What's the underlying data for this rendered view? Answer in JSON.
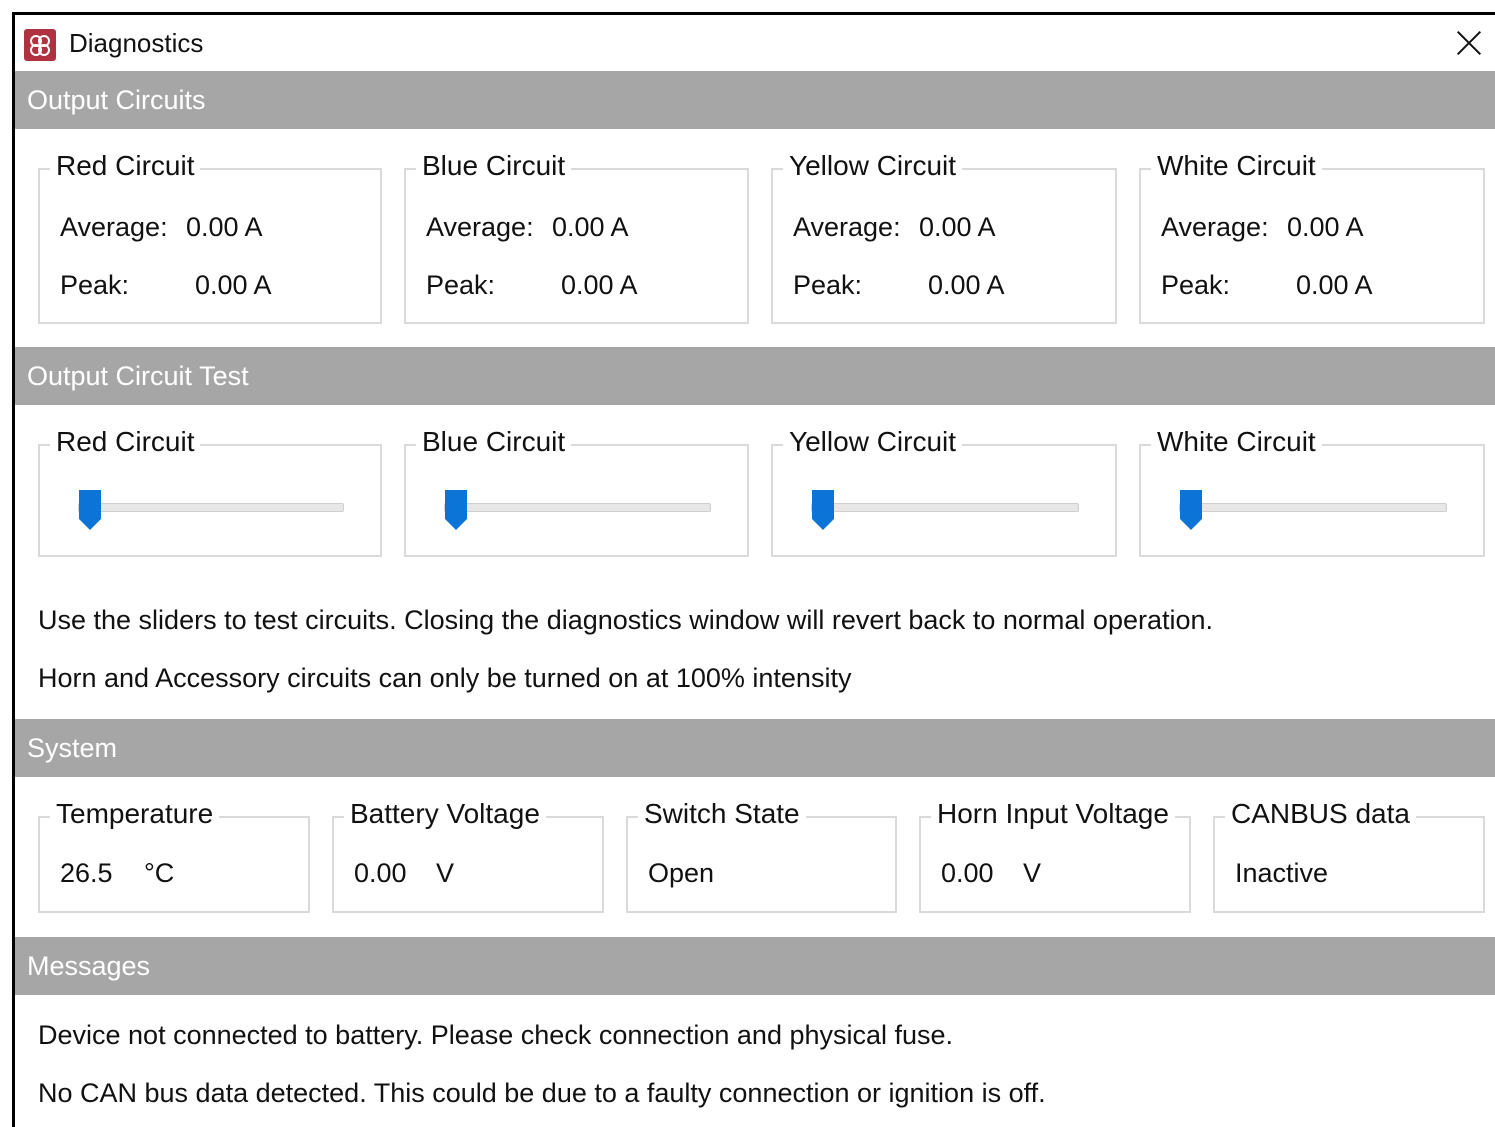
{
  "window": {
    "title": "Diagnostics"
  },
  "sections": {
    "output_circuits": "Output Circuits",
    "output_test": "Output Circuit Test",
    "system": "System",
    "messages": "Messages"
  },
  "output_circuits": [
    {
      "name": "Red Circuit",
      "avg_label": "Average:",
      "avg": "0.00 A",
      "peak_label": "Peak:",
      "peak": "0.00 A"
    },
    {
      "name": "Blue Circuit",
      "avg_label": "Average:",
      "avg": "0.00 A",
      "peak_label": "Peak:",
      "peak": "0.00 A"
    },
    {
      "name": "Yellow Circuit",
      "avg_label": "Average:",
      "avg": "0.00 A",
      "peak_label": "Peak:",
      "peak": "0.00 A"
    },
    {
      "name": "White Circuit",
      "avg_label": "Average:",
      "avg": "0.00 A",
      "peak_label": "Peak:",
      "peak": "0.00 A"
    }
  ],
  "test_sliders": [
    {
      "name": "Red Circuit",
      "level": 0
    },
    {
      "name": "Blue Circuit",
      "level": 0
    },
    {
      "name": "Yellow Circuit",
      "level": 0
    },
    {
      "name": "White Circuit",
      "level": 0
    }
  ],
  "test_notes": [
    "Use the sliders to test circuits. Closing the diagnostics window will revert back to normal operation.",
    "Horn and Accessory circuits can only be turned on at 100% intensity"
  ],
  "system": [
    {
      "name": "Temperature",
      "value": "26.5",
      "unit": "°C"
    },
    {
      "name": "Battery Voltage",
      "value": "0.00",
      "unit": "V"
    },
    {
      "name": "Switch State",
      "value": "Open",
      "unit": ""
    },
    {
      "name": "Horn Input Voltage",
      "value": "0.00",
      "unit": "V"
    },
    {
      "name": "CANBUS data",
      "value": "Inactive",
      "unit": ""
    }
  ],
  "messages": [
    "Device not connected to battery. Please check connection and physical fuse.",
    "No CAN bus data detected. This could be due to a faulty connection or ignition is off."
  ],
  "colors": {
    "header_bg": "#a6a6a6",
    "slider_accent": "#0b74d6",
    "app_icon": "#b0313f"
  }
}
